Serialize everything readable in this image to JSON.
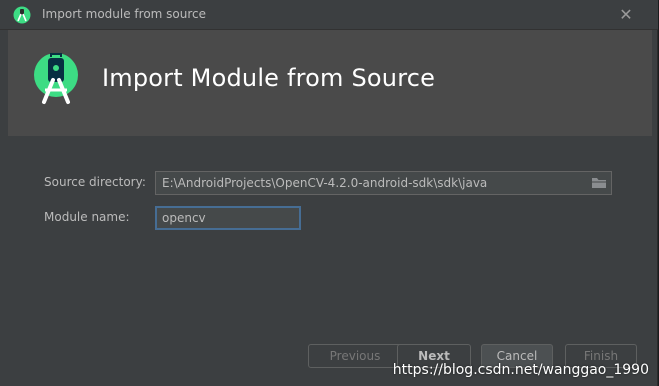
{
  "window": {
    "title": "Import module from source",
    "close_glyph": "✕"
  },
  "banner": {
    "title": "Import Module from Source",
    "logo_icon": "android-studio-logo"
  },
  "form": {
    "source_directory": {
      "label": "Source directory:",
      "value": "E:\\AndroidProjects\\OpenCV-4.2.0-android-sdk\\sdk\\java",
      "browse_icon": "folder-icon"
    },
    "module_name": {
      "label": "Module name:",
      "value": "opencv"
    }
  },
  "buttons": {
    "previous": "Previous",
    "next": "Next",
    "cancel": "Cancel",
    "finish": "Finish"
  },
  "watermark": "https://blog.csdn.net/wanggao_1990",
  "colors": {
    "accent": "#3ddc84",
    "focus_border": "#466d94",
    "banner_bg": "#4a4a4a",
    "dialog_bg": "#3c3f41"
  }
}
